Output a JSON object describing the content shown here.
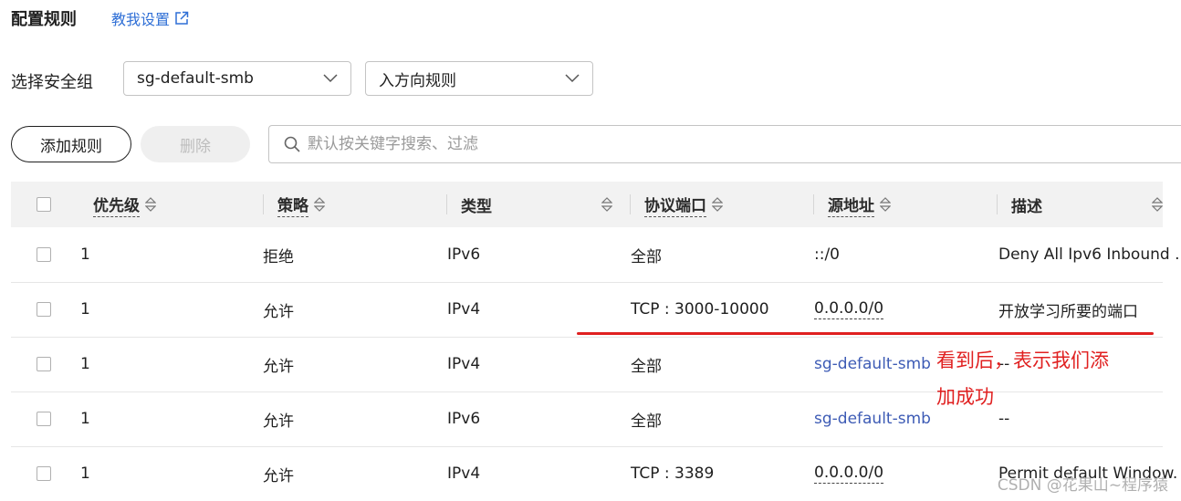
{
  "header": {
    "title": "配置规则",
    "guide_link": "教我设置"
  },
  "filters": {
    "label": "选择安全组",
    "security_group": "sg-default-smb",
    "direction": "入方向规则"
  },
  "toolbar": {
    "add_label": "添加规则",
    "delete_label": "删除",
    "search_placeholder": "默认按关键字搜索、过滤"
  },
  "table": {
    "columns": [
      "优先级",
      "策略",
      "类型",
      "协议端口",
      "源地址",
      "描述"
    ],
    "rows": [
      {
        "priority": "1",
        "policy": "拒绝",
        "type": "IPv6",
        "port": "全部",
        "source": "::/0",
        "desc": "Deny All Ipv6 Inbound ."
      },
      {
        "priority": "1",
        "policy": "允许",
        "type": "IPv4",
        "port": "TCP : 3000-10000",
        "source": "0.0.0.0/0",
        "desc": "开放学习所要的端口"
      },
      {
        "priority": "1",
        "policy": "允许",
        "type": "IPv4",
        "port": "全部",
        "source": "sg-default-smb",
        "desc": "--"
      },
      {
        "priority": "1",
        "policy": "允许",
        "type": "IPv6",
        "port": "全部",
        "source": "sg-default-smb",
        "desc": "--"
      },
      {
        "priority": "1",
        "policy": "允许",
        "type": "IPv4",
        "port": "TCP : 3389",
        "source": "0.0.0.0/0",
        "desc": "Permit default Window."
      }
    ]
  },
  "annotation": {
    "line1": "看到后，表示我们添",
    "line2": "加成功",
    "color": "#e02020"
  },
  "watermark": "CSDN @花果山~程序猿",
  "colors": {
    "link": "#2f6fd6",
    "sg_link": "#3d5bb5",
    "header_bg": "#f2f2f2",
    "disabled_bg": "#efefef"
  }
}
